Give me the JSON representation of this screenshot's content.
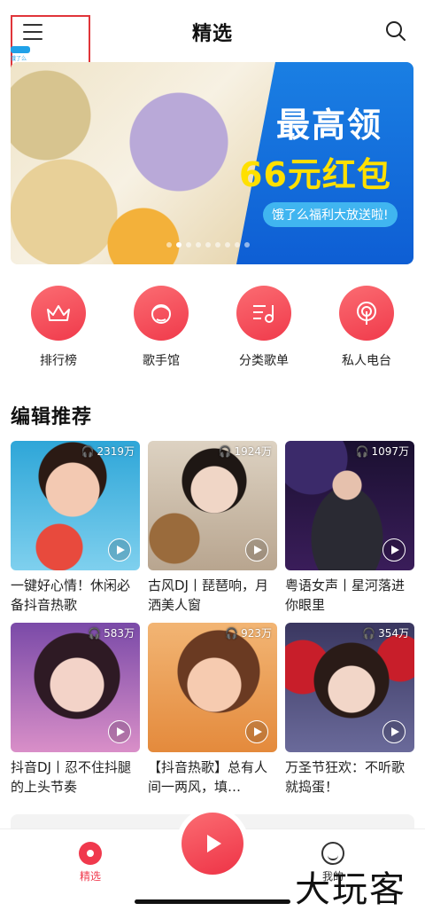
{
  "header": {
    "title": "精选"
  },
  "banner": {
    "line1": "最高领",
    "line2": "66元红包",
    "tag": "饿了么福利大放送啦!",
    "ad_logo_text": "饿了么"
  },
  "quick_actions": [
    {
      "label": "排行榜",
      "icon": "crown-icon"
    },
    {
      "label": "歌手馆",
      "icon": "singer-avatar-icon"
    },
    {
      "label": "分类歌单",
      "icon": "playlist-icon"
    },
    {
      "label": "私人电台",
      "icon": "radio-icon"
    }
  ],
  "section": {
    "title": "编辑推荐"
  },
  "playlists": [
    {
      "title": "一键好心情！休闲必备抖音热歌",
      "count": "2319万"
    },
    {
      "title": "古风DJ丨琵琶响，月洒美人窗",
      "count": "1924万"
    },
    {
      "title": "粤语女声丨星河落进你眼里",
      "count": "1097万"
    },
    {
      "title": "抖音DJ丨忍不住抖腿的上头节奏",
      "count": "583万"
    },
    {
      "title": "【抖音热歌】总有人间一两风，填…",
      "count": "923万"
    },
    {
      "title": "万圣节狂欢：不听歌就捣蛋！",
      "count": "354万"
    }
  ],
  "tabbar": {
    "tabs": [
      {
        "label": "精选",
        "active": true
      },
      {
        "label": "我的",
        "active": false
      }
    ]
  },
  "watermark": "大玩客",
  "colors": {
    "accent": "#f0394d",
    "banner_blue": "#1a7fe3",
    "banner_yellow": "#ffe000"
  }
}
